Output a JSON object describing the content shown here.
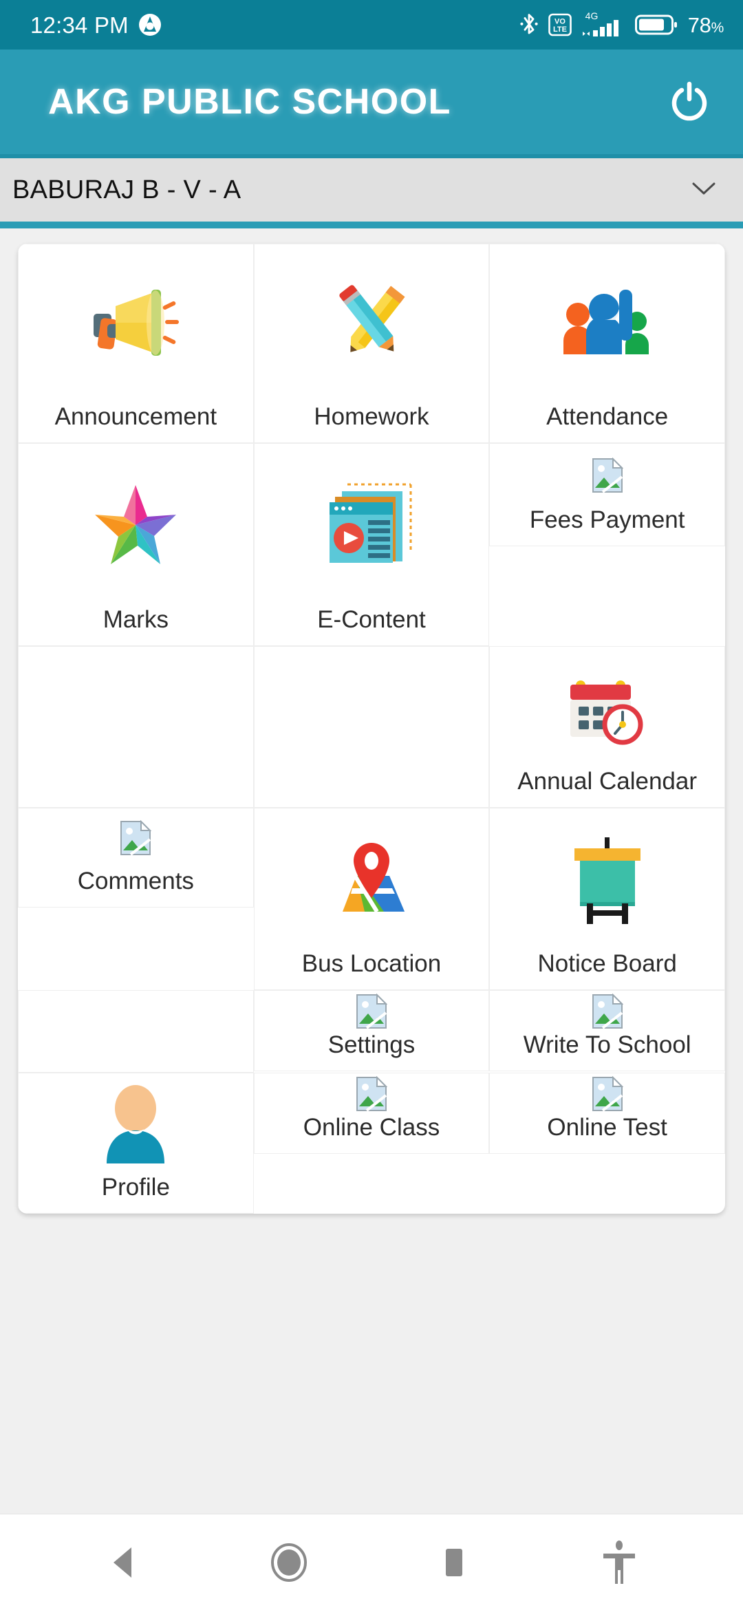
{
  "status_bar": {
    "time": "12:34 PM",
    "app_badge_icon": "app-logo-a-icon",
    "bluetooth_icon": "bluetooth-icon",
    "volte_label_top": "VO",
    "volte_label_bottom": "LTE",
    "network_label": "4G",
    "signal_icon": "signal-bars-icon",
    "battery_icon": "battery-icon",
    "battery_percent": "78",
    "battery_percent_symbol": "%",
    "bar_color": "#0b7f96"
  },
  "header": {
    "title": "AKG PUBLIC SCHOOL",
    "power_icon": "power-icon",
    "bg_color": "#2a9cb5"
  },
  "student_selector": {
    "value": "BABURAJ B - V - A",
    "chevron_icon": "chevron-down-icon",
    "bg_color": "#e0e0e0",
    "accent_color": "#2a9cb5"
  },
  "grid": {
    "rows": [
      {
        "cells": [
          {
            "label": "Announcement",
            "icon": "megaphone-icon",
            "height_class": "h-290",
            "type": "tile"
          },
          {
            "label": "Homework",
            "icon": "crossed-pencils-icon",
            "height_class": "h-290",
            "type": "tile"
          },
          {
            "label": "Attendance",
            "icon": "people-raising-hand-icon",
            "height_class": "h-290",
            "type": "tile"
          }
        ]
      },
      {
        "cells": [
          {
            "label": "Marks",
            "icon": "colorful-star-icon",
            "height_class": "h-295",
            "type": "tile"
          },
          {
            "label": "E-Content",
            "icon": "media-documents-icon",
            "height_class": "h-295",
            "type": "tile"
          },
          {
            "label": "Fees Payment",
            "icon": "broken-image-icon",
            "height_class": "h-150",
            "type": "tile"
          }
        ]
      },
      {
        "cells": [
          {
            "label": "",
            "icon": "",
            "height_class": "h-235",
            "type": "blank"
          },
          {
            "label": "",
            "icon": "",
            "height_class": "h-235",
            "type": "blank"
          },
          {
            "label": "Annual Calendar",
            "icon": "calendar-clock-icon",
            "height_class": "h-235",
            "type": "tile"
          }
        ]
      },
      {
        "cells": [
          {
            "label": "Comments",
            "icon": "broken-image-icon",
            "height_class": "h-145",
            "type": "tile"
          },
          {
            "label": "Bus Location",
            "icon": "map-pin-icon",
            "height_class": "h-265",
            "type": "tile"
          },
          {
            "label": "Notice Board",
            "icon": "notice-board-icon",
            "height_class": "h-265",
            "type": "tile"
          }
        ]
      },
      {
        "cells": [
          {
            "label": "",
            "icon": "",
            "height_class": "h-120",
            "type": "blank"
          },
          {
            "label": "Settings",
            "icon": "broken-image-icon",
            "height_class": "h-118",
            "type": "tile"
          },
          {
            "label": "Write To School",
            "icon": "broken-image-icon",
            "height_class": "h-118",
            "type": "tile"
          }
        ]
      },
      {
        "cells": [
          {
            "label": "Profile",
            "icon": "person-avatar-icon",
            "height_class": "h-205",
            "type": "tile"
          },
          {
            "label": "Online Class",
            "icon": "broken-image-icon",
            "height_class": "h-118",
            "type": "tile"
          },
          {
            "label": "Online Test",
            "icon": "broken-image-icon",
            "height_class": "h-118",
            "type": "tile"
          }
        ]
      }
    ]
  },
  "nav_bar": {
    "buttons": [
      {
        "name": "back-button",
        "icon": "back-triangle-icon"
      },
      {
        "name": "home-button",
        "icon": "home-circle-icon"
      },
      {
        "name": "recents-button",
        "icon": "recents-square-icon"
      },
      {
        "name": "accessibility-button",
        "icon": "accessibility-person-icon"
      }
    ],
    "icon_color": "#8a8a8a"
  }
}
